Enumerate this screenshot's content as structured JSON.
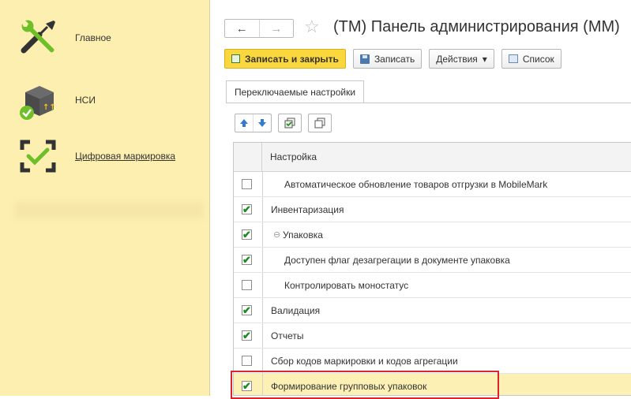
{
  "sidebar": {
    "items": [
      {
        "label": "Главное",
        "icon": "wrench-screwdriver-icon"
      },
      {
        "label": "НСИ",
        "icon": "box-check-icon"
      },
      {
        "label": "Цифровая маркировка",
        "icon": "scan-frame-icon"
      }
    ]
  },
  "header": {
    "back": "←",
    "forward": "→",
    "star": "☆",
    "title": "(ТМ) Панель администрирования (ММ)"
  },
  "toolbar": {
    "save_close": "Записать и закрыть",
    "save": "Записать",
    "actions": "Действия",
    "actions_arrow": "▾",
    "list": "Список"
  },
  "tabs": [
    {
      "label": "Переключаемые настройки"
    }
  ],
  "table": {
    "header": "Настройка",
    "rows": [
      {
        "label": "Автоматическое обновление товаров отгрузки в MobileMark",
        "checked": false,
        "level": 2
      },
      {
        "label": "Инвентаризация",
        "checked": true,
        "level": 1
      },
      {
        "label": "Упаковка",
        "checked": true,
        "level": 0,
        "expander": "⊖"
      },
      {
        "label": "Доступен флаг дезагрегации в документе упаковка",
        "checked": true,
        "level": 2
      },
      {
        "label": "Контролировать моностатус",
        "checked": false,
        "level": 2
      },
      {
        "label": "Валидация",
        "checked": true,
        "level": 1
      },
      {
        "label": "Отчеты",
        "checked": true,
        "level": 1
      },
      {
        "label": "Сбор кодов маркировки и кодов агрегации",
        "checked": false,
        "level": 1
      },
      {
        "label": "Формирование групповых упаковок",
        "checked": true,
        "level": 1,
        "highlighted": true
      }
    ]
  },
  "colors": {
    "sidebar_bg": "#fcefaf",
    "primary_button": "#fad73c",
    "highlight_border": "#e0232a",
    "check": "#1e8a1e"
  }
}
